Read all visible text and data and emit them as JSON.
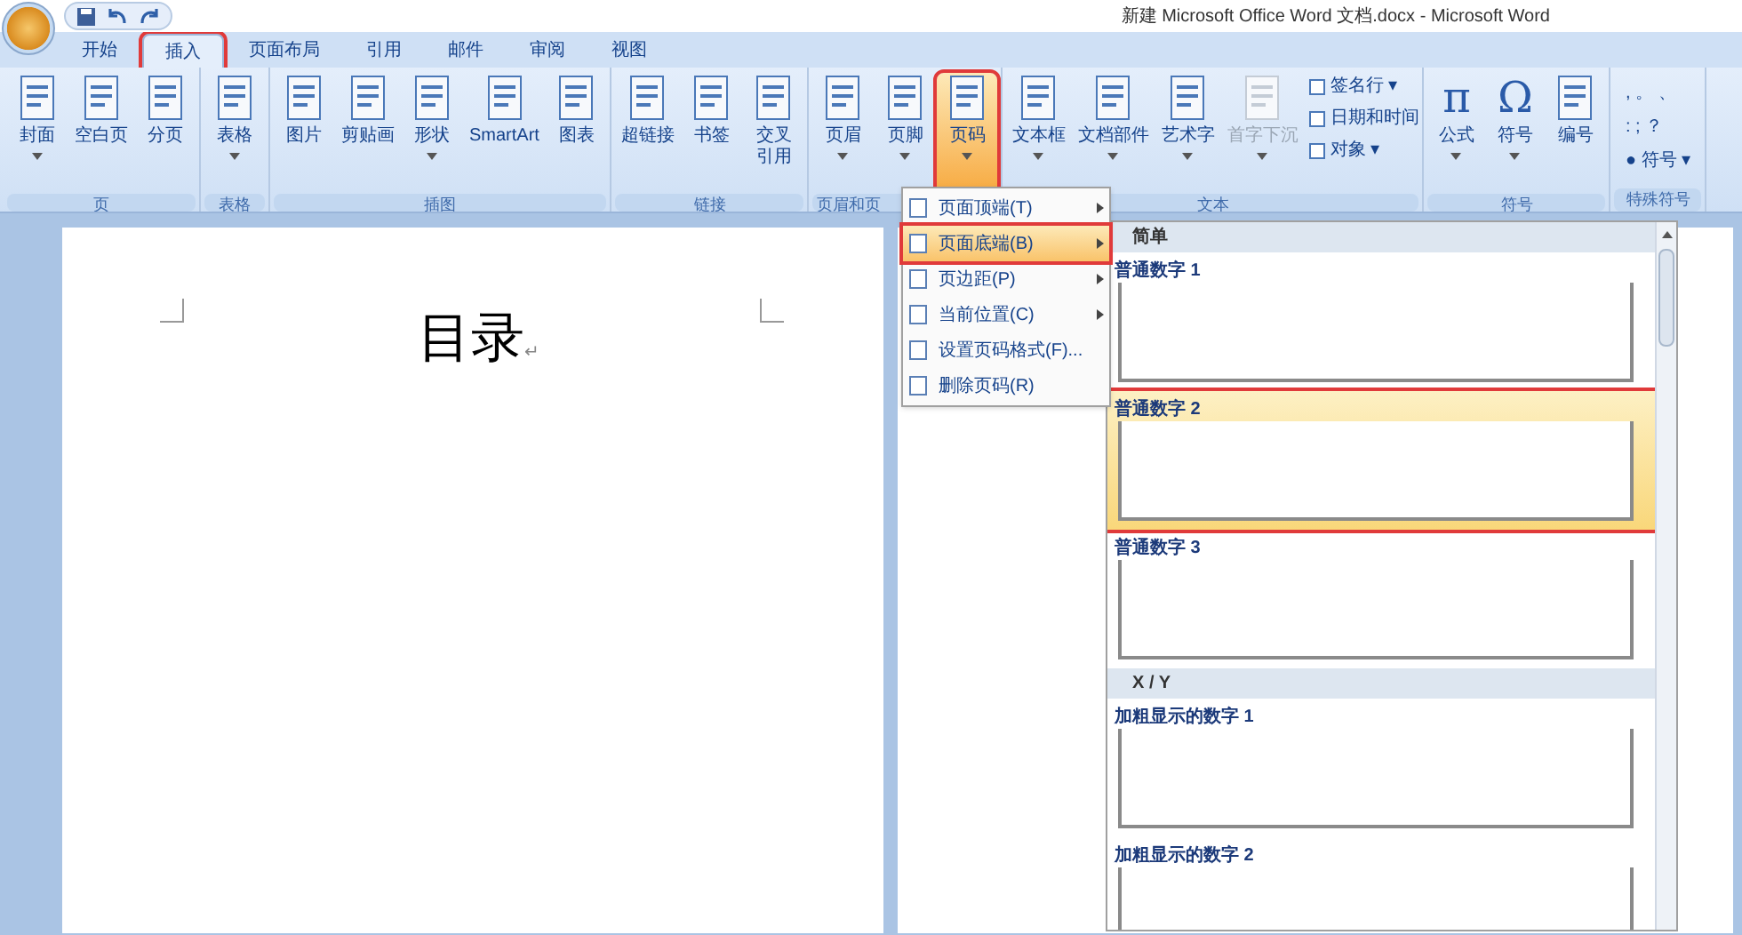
{
  "window": {
    "title": "新建 Microsoft Office Word 文档.docx - Microsoft Word"
  },
  "tabs": [
    {
      "label": "开始",
      "selected": false,
      "marked": false
    },
    {
      "label": "插入",
      "selected": true,
      "marked": true
    },
    {
      "label": "页面布局",
      "selected": false,
      "marked": false
    },
    {
      "label": "引用",
      "selected": false,
      "marked": false
    },
    {
      "label": "邮件",
      "selected": false,
      "marked": false
    },
    {
      "label": "审阅",
      "selected": false,
      "marked": false
    },
    {
      "label": "视图",
      "selected": false,
      "marked": false
    }
  ],
  "ribbon_groups": [
    {
      "label": "页",
      "buttons": [
        {
          "label": "封面",
          "has_menu": true,
          "disabled": false,
          "pressed": false,
          "marked": false
        },
        {
          "label": "空白页",
          "has_menu": false,
          "disabled": false,
          "pressed": false,
          "marked": false
        },
        {
          "label": "分页",
          "has_menu": false,
          "disabled": false,
          "pressed": false,
          "marked": false
        }
      ]
    },
    {
      "label": "表格",
      "buttons": [
        {
          "label": "表格",
          "has_menu": true,
          "disabled": false,
          "pressed": false,
          "marked": false
        }
      ]
    },
    {
      "label": "插图",
      "buttons": [
        {
          "label": "图片",
          "has_menu": false,
          "disabled": false,
          "pressed": false,
          "marked": false
        },
        {
          "label": "剪贴画",
          "has_menu": false,
          "disabled": false,
          "pressed": false,
          "marked": false
        },
        {
          "label": "形状",
          "has_menu": true,
          "disabled": false,
          "pressed": false,
          "marked": false
        },
        {
          "label": "SmartArt",
          "has_menu": false,
          "disabled": false,
          "pressed": false,
          "marked": false
        },
        {
          "label": "图表",
          "has_menu": false,
          "disabled": false,
          "pressed": false,
          "marked": false
        }
      ]
    },
    {
      "label": "链接",
      "buttons": [
        {
          "label": "超链接",
          "has_menu": false,
          "disabled": false,
          "pressed": false,
          "marked": false
        },
        {
          "label": "书签",
          "has_menu": false,
          "disabled": false,
          "pressed": false,
          "marked": false
        },
        {
          "lines": [
            "交叉",
            "引用"
          ],
          "has_menu": false,
          "disabled": false,
          "pressed": false,
          "marked": false
        }
      ]
    },
    {
      "label": "页眉和页",
      "buttons": [
        {
          "label": "页眉",
          "has_menu": true,
          "disabled": false,
          "pressed": false,
          "marked": false
        },
        {
          "label": "页脚",
          "has_menu": true,
          "disabled": false,
          "pressed": false,
          "marked": false
        },
        {
          "label": "页码",
          "has_menu": true,
          "disabled": false,
          "pressed": true,
          "marked": true
        }
      ]
    },
    {
      "label": "文本",
      "buttons": [
        {
          "label": "文本框",
          "has_menu": true,
          "disabled": false,
          "pressed": false,
          "marked": false
        },
        {
          "label": "文档部件",
          "has_menu": true,
          "disabled": false,
          "pressed": false,
          "marked": false
        },
        {
          "label": "艺术字",
          "has_menu": true,
          "disabled": false,
          "pressed": false,
          "marked": false
        },
        {
          "label": "首字下沉",
          "has_menu": true,
          "disabled": true,
          "pressed": false,
          "marked": false
        }
      ],
      "small_buttons": [
        {
          "label": "签名行 ▾"
        },
        {
          "label": "日期和时间"
        },
        {
          "label": "对象 ▾"
        }
      ]
    },
    {
      "label": "符号",
      "buttons": [
        {
          "label": "公式",
          "glyph": "π",
          "has_menu": true,
          "disabled": false,
          "pressed": false,
          "marked": false
        },
        {
          "label": "符号",
          "glyph": "Ω",
          "has_menu": true,
          "disabled": false,
          "pressed": false,
          "marked": false
        },
        {
          "label": "编号",
          "has_menu": false,
          "disabled": false,
          "pressed": false,
          "marked": false
        }
      ]
    },
    {
      "label": "特殊符号",
      "special": {
        "marks": [
          ", 。 、",
          ": ; ？"
        ],
        "button": "● 符号 ▾"
      }
    }
  ],
  "document": {
    "heading": "目录",
    "paragraph_mark": "↵"
  },
  "page_number_menu": {
    "items": [
      {
        "label": "页面顶端(T)",
        "submenu": true,
        "selected": false,
        "marked": false
      },
      {
        "label": "页面底端(B)",
        "submenu": true,
        "selected": true,
        "marked": true
      },
      {
        "label": "页边距(P)",
        "submenu": true,
        "selected": false,
        "marked": false
      },
      {
        "label": "当前位置(C)",
        "submenu": true,
        "selected": false,
        "marked": false
      },
      {
        "label": "设置页码格式(F)...",
        "submenu": false,
        "selected": false,
        "marked": false
      },
      {
        "label": "删除页码(R)",
        "submenu": false,
        "selected": false,
        "marked": false
      }
    ]
  },
  "gallery": {
    "sections": [
      {
        "header": "简单",
        "items": [
          {
            "label": "普通数字 1",
            "selected": false,
            "marked": false
          },
          {
            "label": "普通数字 2",
            "selected": true,
            "marked": true
          },
          {
            "label": "普通数字 3",
            "selected": false,
            "marked": false
          }
        ]
      },
      {
        "header": "X / Y",
        "items": [
          {
            "label": "加粗显示的数字 1",
            "selected": false,
            "marked": false
          },
          {
            "label": "加粗显示的数字 2",
            "selected": false,
            "marked": false
          }
        ]
      }
    ]
  }
}
